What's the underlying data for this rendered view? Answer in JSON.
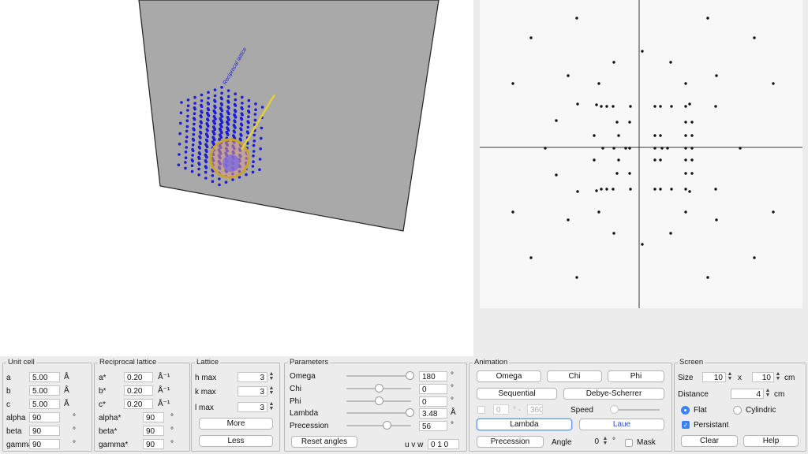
{
  "scene": {
    "caption": "Reciprocal lattice",
    "color_lattice": "#1c1cd6",
    "color_ewald": "#d8b43c",
    "color_screen": "#a9a9a9"
  },
  "unit_cell": {
    "title": "Unit cell",
    "rows": [
      {
        "label": "a",
        "value": "5.00",
        "unit": "Å"
      },
      {
        "label": "b",
        "value": "5.00",
        "unit": "Å"
      },
      {
        "label": "c",
        "value": "5.00",
        "unit": "Å"
      },
      {
        "label": "alpha",
        "value": "90",
        "unit": "°"
      },
      {
        "label": "beta",
        "value": "90",
        "unit": "°"
      },
      {
        "label": "gamma",
        "value": "90",
        "unit": "°"
      }
    ]
  },
  "reciprocal": {
    "title": "Reciprocal lattice",
    "rows": [
      {
        "label": "a*",
        "value": "0.20",
        "unit": "Å⁻¹"
      },
      {
        "label": "b*",
        "value": "0.20",
        "unit": "Å⁻¹"
      },
      {
        "label": "c*",
        "value": "0.20",
        "unit": "Å⁻¹"
      },
      {
        "label": "alpha*",
        "value": "90",
        "unit": "°"
      },
      {
        "label": "beta*",
        "value": "90",
        "unit": "°"
      },
      {
        "label": "gamma*",
        "value": "90",
        "unit": "°"
      }
    ]
  },
  "lattice": {
    "title": "Lattice",
    "rows": [
      {
        "label": "h max",
        "value": "3"
      },
      {
        "label": "k max",
        "value": "3"
      },
      {
        "label": "l  max",
        "value": "3"
      }
    ],
    "more": "More",
    "less": "Less"
  },
  "parameters": {
    "title": "Parameters",
    "rows": [
      {
        "label": "Omega",
        "value": "180",
        "unit": "°",
        "slider": 0.98
      },
      {
        "label": "Chi",
        "value": "0",
        "unit": "°",
        "slider": 0.5
      },
      {
        "label": "Phi",
        "value": "0",
        "unit": "°",
        "slider": 0.5
      },
      {
        "label": "Lambda",
        "value": "3.48",
        "unit": "Å",
        "slider": 0.98
      },
      {
        "label": "Precession",
        "value": "56",
        "unit": "°",
        "slider": 0.62
      }
    ],
    "reset": "Reset angles",
    "uvw_label": "u v w",
    "uvw_value": "0 1 0"
  },
  "animation": {
    "title": "Animation",
    "omega": "Omega",
    "chi": "Chi",
    "phi": "Phi",
    "sequential": "Sequential",
    "debye": "Debye-Scherrer",
    "range_from": "0",
    "range_deg": "° -",
    "range_to": "360",
    "speed": "Speed",
    "lambda": "Lambda",
    "laue": "Laue",
    "precession": "Precession",
    "angle_label": "Angle",
    "angle_value": "0",
    "angle_unit": "°",
    "mask": "Mask"
  },
  "screen": {
    "title": "Screen",
    "size_label": "Size",
    "size_w": "10",
    "size_x": "x",
    "size_h": "10",
    "size_unit": "cm",
    "distance_label": "Distance",
    "distance_value": "4",
    "distance_unit": "cm",
    "flat": "Flat",
    "cylindric": "Cylindric",
    "persistant": "Persistant",
    "clear": "Clear",
    "help": "Help"
  }
}
